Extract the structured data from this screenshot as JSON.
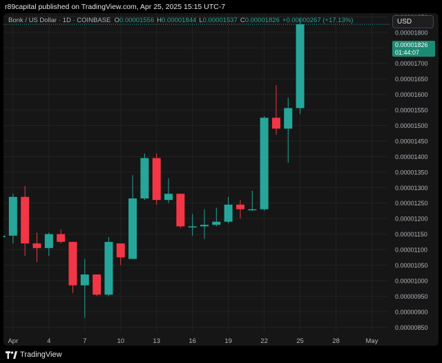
{
  "header": {
    "publish_text": "r89capital published on TradingView.com, Apr 25, 2025 15:15 UTC-7"
  },
  "legend": {
    "symbol": "Bonk / US Dollar · 1D · COINBASE",
    "open_label": "O",
    "open_value": "0.00001556",
    "high_label": "H",
    "high_value": "0.00001844",
    "low_label": "L",
    "low_value": "0.00001537",
    "close_label": "C",
    "close_value": "0.00001826",
    "change": "+0.00000267 (+17.13%)"
  },
  "currency": {
    "label": "USD"
  },
  "price_tag": {
    "price": "0.00001826",
    "countdown": "01:44:07"
  },
  "footer": {
    "brand": "TradingView"
  },
  "colors": {
    "up": "#26a69a",
    "down": "#f23645",
    "background": "#161616",
    "grid": "#232323",
    "text": "#b2b5be"
  },
  "chart_data": {
    "type": "candlestick",
    "y_ticks": [
      "0.00001850",
      "0.00001800",
      "0.00001750",
      "0.00001700",
      "0.00001650",
      "0.00001600",
      "0.00001550",
      "0.00001500",
      "0.00001450",
      "0.00001400",
      "0.00001350",
      "0.00001300",
      "0.00001250",
      "0.00001200",
      "0.00001150",
      "0.00001100",
      "0.00001050",
      "0.00001000",
      "0.00000950",
      "0.00000900",
      "0.00000850"
    ],
    "x_ticks": [
      {
        "label": "Apr",
        "day": 1
      },
      {
        "label": "4",
        "day": 4
      },
      {
        "label": "7",
        "day": 7
      },
      {
        "label": "10",
        "day": 10
      },
      {
        "label": "13",
        "day": 13
      },
      {
        "label": "16",
        "day": 16
      },
      {
        "label": "19",
        "day": 19
      },
      {
        "label": "22",
        "day": 22
      },
      {
        "label": "25",
        "day": 25
      },
      {
        "label": "28",
        "day": 28
      },
      {
        "label": "May",
        "day": 31
      }
    ],
    "ylim": [
      8.35e-06,
      1.862e-05
    ],
    "xlim": [
      0.2,
      32.3
    ],
    "grid": true,
    "candles": [
      {
        "day": 0,
        "o": 1.14e-05,
        "h": 1.15e-05,
        "l": 1.135e-05,
        "c": 1.145e-05
      },
      {
        "day": 1,
        "o": 1.145e-05,
        "h": 1.28e-05,
        "l": 1.12e-05,
        "c": 1.27e-05
      },
      {
        "day": 2,
        "o": 1.27e-05,
        "h": 1.305e-05,
        "l": 1.08e-05,
        "c": 1.12e-05
      },
      {
        "day": 3,
        "o": 1.12e-05,
        "h": 1.155e-05,
        "l": 1.06e-05,
        "c": 1.105e-05
      },
      {
        "day": 4,
        "o": 1.105e-05,
        "h": 1.155e-05,
        "l": 1.08e-05,
        "c": 1.15e-05
      },
      {
        "day": 5,
        "o": 1.15e-05,
        "h": 1.165e-05,
        "l": 1.12e-05,
        "c": 1.125e-05
      },
      {
        "day": 6,
        "o": 1.125e-05,
        "h": 1.125e-05,
        "l": 9.6e-06,
        "c": 9.85e-06
      },
      {
        "day": 7,
        "o": 9.85e-06,
        "h": 1.07e-05,
        "l": 8.8e-06,
        "c": 1.02e-05
      },
      {
        "day": 8,
        "o": 1.02e-05,
        "h": 1.02e-05,
        "l": 9.5e-06,
        "c": 9.55e-06
      },
      {
        "day": 9,
        "o": 9.55e-06,
        "h": 1.14e-05,
        "l": 9.5e-06,
        "c": 1.125e-05
      },
      {
        "day": 10,
        "o": 1.12e-05,
        "h": 1.12e-05,
        "l": 1.05e-05,
        "c": 1.075e-05
      },
      {
        "day": 11,
        "o": 1.07e-05,
        "h": 1.34e-05,
        "l": 1.07e-05,
        "c": 1.265e-05
      },
      {
        "day": 12,
        "o": 1.265e-05,
        "h": 1.41e-05,
        "l": 1.26e-05,
        "c": 1.395e-05
      },
      {
        "day": 13,
        "o": 1.395e-05,
        "h": 1.41e-05,
        "l": 1.245e-05,
        "c": 1.26e-05
      },
      {
        "day": 14,
        "o": 1.26e-05,
        "h": 1.33e-05,
        "l": 1.25e-05,
        "c": 1.28e-05
      },
      {
        "day": 15,
        "o": 1.28e-05,
        "h": 1.28e-05,
        "l": 1.17e-05,
        "c": 1.175e-05
      },
      {
        "day": 16,
        "o": 1.175e-05,
        "h": 1.215e-05,
        "l": 1.145e-05,
        "c": 1.175e-05
      },
      {
        "day": 17,
        "o": 1.175e-05,
        "h": 1.23e-05,
        "l": 1.135e-05,
        "c": 1.18e-05
      },
      {
        "day": 18,
        "o": 1.18e-05,
        "h": 1.235e-05,
        "l": 1.175e-05,
        "c": 1.19e-05
      },
      {
        "day": 19,
        "o": 1.19e-05,
        "h": 1.27e-05,
        "l": 1.185e-05,
        "c": 1.245e-05
      },
      {
        "day": 20,
        "o": 1.245e-05,
        "h": 1.26e-05,
        "l": 1.2e-05,
        "c": 1.23e-05
      },
      {
        "day": 21,
        "o": 1.23e-05,
        "h": 1.29e-05,
        "l": 1.225e-05,
        "c": 1.23e-05
      },
      {
        "day": 22,
        "o": 1.23e-05,
        "h": 1.53e-05,
        "l": 1.225e-05,
        "c": 1.525e-05
      },
      {
        "day": 23,
        "o": 1.525e-05,
        "h": 1.63e-05,
        "l": 1.47e-05,
        "c": 1.49e-05
      },
      {
        "day": 24,
        "o": 1.49e-05,
        "h": 1.59e-05,
        "l": 1.38e-05,
        "c": 1.556e-05
      },
      {
        "day": 25,
        "o": 1.556e-05,
        "h": 1.844e-05,
        "l": 1.537e-05,
        "c": 1.826e-05
      }
    ]
  }
}
